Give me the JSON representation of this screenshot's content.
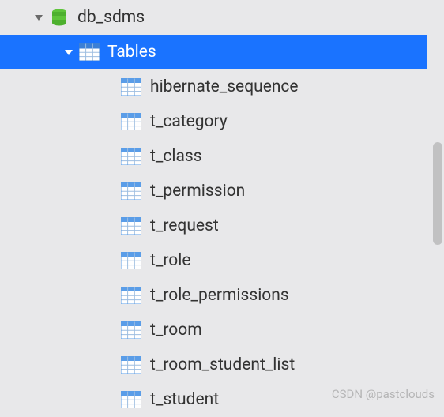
{
  "database": {
    "name": "db_sdms"
  },
  "tablesGroup": {
    "label": "Tables"
  },
  "tables": [
    {
      "name": "hibernate_sequence"
    },
    {
      "name": "t_category"
    },
    {
      "name": "t_class"
    },
    {
      "name": "t_permission"
    },
    {
      "name": "t_request"
    },
    {
      "name": "t_role"
    },
    {
      "name": "t_role_permissions"
    },
    {
      "name": "t_room"
    },
    {
      "name": "t_room_student_list"
    },
    {
      "name": "t_student"
    }
  ],
  "watermark": "CSDN @pastclouds"
}
